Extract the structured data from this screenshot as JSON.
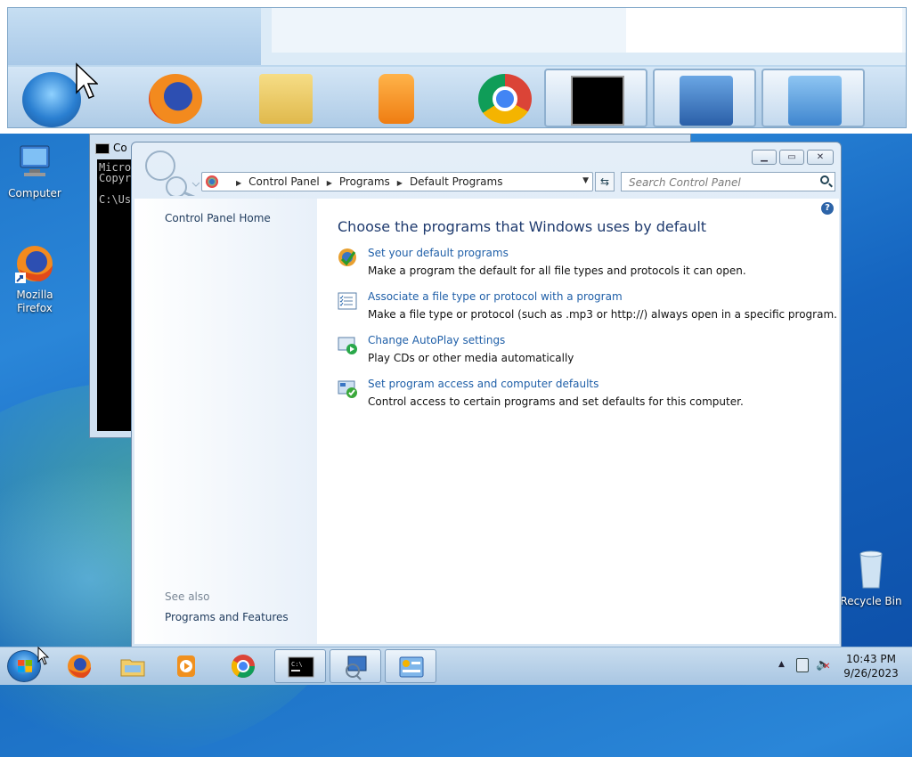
{
  "desktop": {
    "icons": [
      {
        "label": "Computer"
      },
      {
        "label": "Mozilla Firefox"
      },
      {
        "label": "Recycle Bin"
      }
    ]
  },
  "cmd_window": {
    "title": "Co",
    "console_text": "Micro\nCopyr\n\nC:\\Us"
  },
  "control_panel": {
    "breadcrumb": [
      "Control Panel",
      "Programs",
      "Default Programs"
    ],
    "search_placeholder": "Search Control Panel",
    "left_pane": {
      "home_link": "Control Panel Home",
      "see_also": "See also",
      "see_also_links": [
        "Programs and Features"
      ]
    },
    "heading": "Choose the programs that Windows uses by default",
    "tasks": [
      {
        "link": "Set your default programs",
        "desc": "Make a program the default for all file types and protocols it can open.",
        "icon": "default-programs-icon"
      },
      {
        "link": "Associate a file type or protocol with a program",
        "desc": "Make a file type or protocol (such as .mp3 or http://) always open in a specific program.",
        "icon": "file-association-icon"
      },
      {
        "link": "Change AutoPlay settings",
        "desc": "Play CDs or other media automatically",
        "icon": "autoplay-icon"
      },
      {
        "link": "Set program access and computer defaults",
        "desc": "Control access to certain programs and set defaults for this computer.",
        "icon": "program-access-icon"
      }
    ]
  },
  "taskbar": {
    "pinned": [
      "firefox-icon",
      "explorer-icon",
      "media-player-icon",
      "chrome-icon",
      "cmd-icon",
      "remote-desktop-icon",
      "control-panel-icon"
    ],
    "clock_time": "10:43 PM",
    "clock_date": "9/26/2023"
  }
}
